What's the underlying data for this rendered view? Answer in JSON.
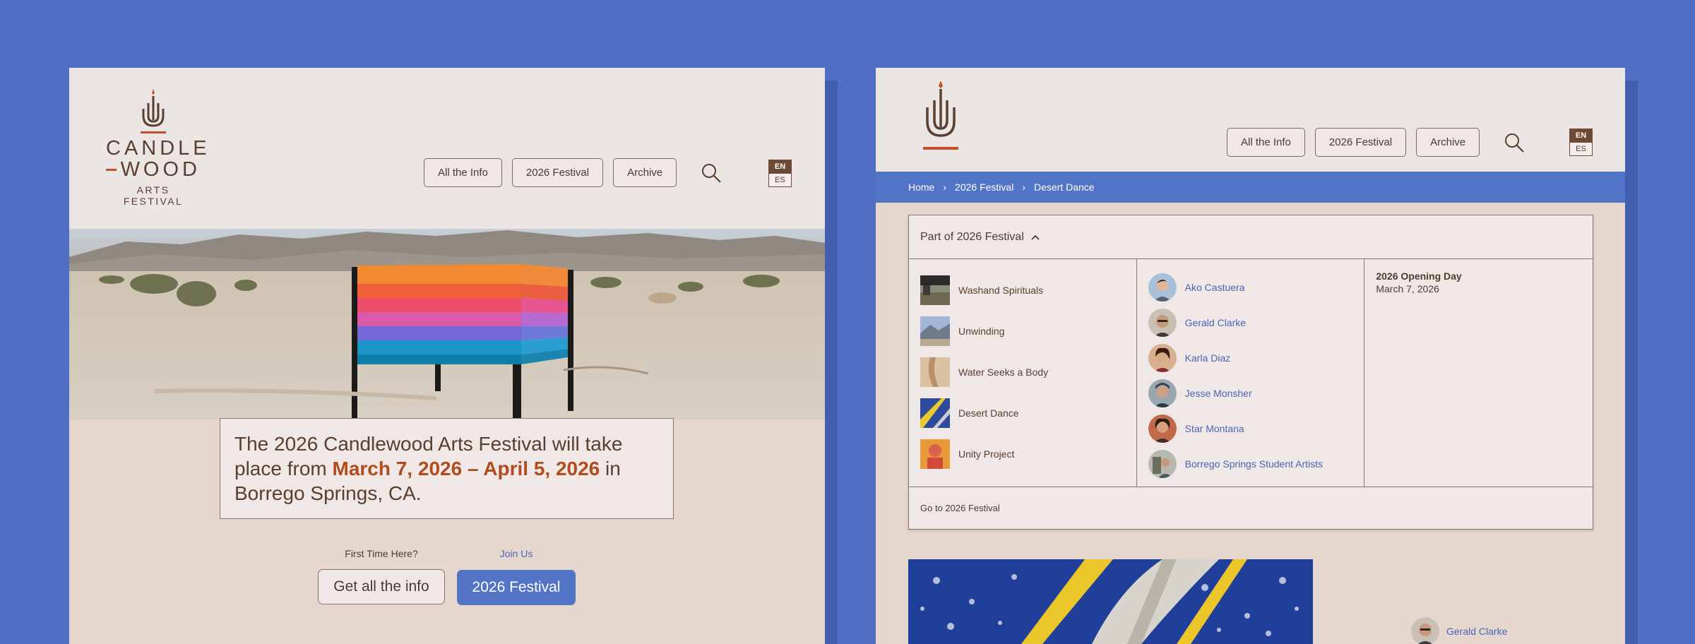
{
  "brand": {
    "word1": "CANDLE",
    "word2": "WOOD",
    "subtitle": "ARTS FESTIVAL",
    "accent": "#c2502a",
    "brown": "#5a3e30"
  },
  "nav": {
    "all_info": "All the Info",
    "festival": "2026 Festival",
    "archive": "Archive",
    "search_icon": "search-icon",
    "lang_en": "EN",
    "lang_es": "ES"
  },
  "hero": {
    "announce_pre": "The 2026 Candlewood Arts Festival will take place from",
    "announce_dates": "March 7, 2026 – April 5, 2026",
    "announce_post": "in Borrego Springs, CA."
  },
  "cta": {
    "first_time_label": "First Time Here?",
    "join_label": "Join Us",
    "info_button": "Get all the info",
    "festival_button": "2026 Festival"
  },
  "breadcrumb": {
    "home": "Home",
    "sep": "›",
    "festival": "2026 Festival",
    "current": "Desert Dance"
  },
  "dropdown": {
    "title": "Part of 2026 Festival",
    "chevron": "^",
    "works": [
      {
        "label": "Washand Spirituals"
      },
      {
        "label": "Unwinding"
      },
      {
        "label": "Water Seeks a Body"
      },
      {
        "label": "Desert Dance"
      },
      {
        "label": "Unity Project"
      }
    ],
    "artists": [
      {
        "label": "Ako Castuera"
      },
      {
        "label": "Gerald Clarke"
      },
      {
        "label": "Karla Diaz"
      },
      {
        "label": "Jesse Monsher"
      },
      {
        "label": "Star Montana"
      },
      {
        "label": "Borrego Springs Student Artists"
      }
    ],
    "event_title": "2026 Opening Day",
    "event_date": "March 7, 2026",
    "footer_link": "Go to 2026 Festival"
  },
  "bottom": {
    "artist": "Gerald Clarke"
  },
  "colors": {
    "background": "#5070c6",
    "panel": "#ebe5e3",
    "sand": "#e5d7cd",
    "blue": "#5274c7",
    "link": "#4a64b5"
  }
}
